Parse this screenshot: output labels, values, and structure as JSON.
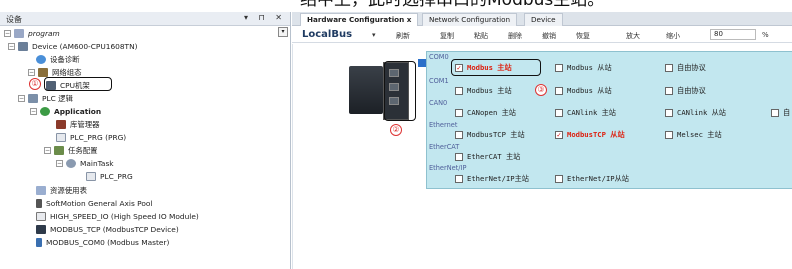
{
  "doc_top_text": "绍中上，此时选择串口的Modbus主站。",
  "left_panel": {
    "title": "设备",
    "buttons": "▾ ⊓ ✕"
  },
  "tree": [
    {
      "label": "program",
      "italic": true
    },
    {
      "label": "Device (AM600-CPU1608TN)"
    },
    {
      "label": "设备诊断"
    },
    {
      "label": "网络组态"
    },
    {
      "label": "CPU机架"
    },
    {
      "label": "PLC 逻辑"
    },
    {
      "label": "Application",
      "bold": true
    },
    {
      "label": "库管理器"
    },
    {
      "label": "PLC_PRG (PRG)"
    },
    {
      "label": "任务配置"
    },
    {
      "label": "MainTask"
    },
    {
      "label": "PLC_PRG"
    },
    {
      "label": "资源使用表"
    },
    {
      "label": "SoftMotion General Axis Pool"
    },
    {
      "label": "HIGH_SPEED_IO (High Speed IO Module)"
    },
    {
      "label": "MODBUS_TCP (ModbusTCP Device)"
    },
    {
      "label": "MODBUS_COM0 (Modbus Master)"
    }
  ],
  "callouts": {
    "one": "①",
    "two": "②",
    "three": "③"
  },
  "tabs": [
    {
      "label": "Hardware Configuration",
      "close": "x"
    },
    {
      "label": "Network Configuration"
    },
    {
      "label": "Device"
    }
  ],
  "toolbar": {
    "bus": "LocalBus",
    "items": [
      "刷新",
      "复制",
      "粘贴",
      "删除",
      "撤销",
      "恢复",
      "放大",
      "缩小"
    ],
    "zoom": "80",
    "zoom_unit": "%"
  },
  "sections": {
    "com0": "COM0",
    "com1": "COM1",
    "can0": "CAN0",
    "ethernet": "Ethernet",
    "ethercat": "EtherCAT",
    "ethernetip": "EtherNet/IP"
  },
  "options": {
    "com0_master": "Modbus 主站",
    "com0_slave": "Modbus 从站",
    "com0_free": "自由协议",
    "com1_master": "Modbus 主站",
    "com1_slave": "Modbus 从站",
    "com1_free": "自由协议",
    "can_master": "CANopen 主站",
    "can_link_m": "CANlink 主站",
    "can_link_s": "CANlink 从站",
    "can_free": "自",
    "tcp_master": "ModbusTCP 主站",
    "tcp_slave": "ModbusTCP 从站",
    "melsec": "Melsec 主站",
    "ecat": "EtherCAT 主站",
    "eip_master": "EtherNet/IP主站",
    "eip_slave": "EtherNet/IP从站"
  },
  "checked": {
    "com0_master": true,
    "tcp_slave": true
  },
  "colors": {
    "config_bg": "#c2e7ef",
    "selected_red": "#d21111",
    "callout": "#d33333"
  }
}
